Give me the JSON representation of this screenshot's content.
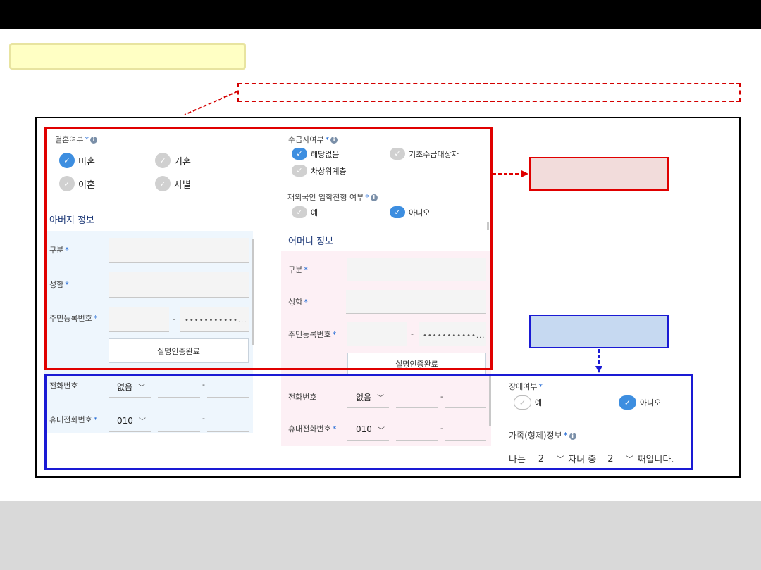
{
  "icons": {
    "check": "check-icon",
    "info": "info-icon",
    "chevron": "chevron-down-icon"
  },
  "colors": {
    "red_highlight": "#e00000",
    "blue_highlight": "#1a1ad4",
    "radio_selected": "#3d8ee0"
  },
  "marital": {
    "label": "결혼여부",
    "required": "*",
    "info": "i",
    "options": [
      {
        "label": "미혼",
        "selected": true
      },
      {
        "label": "기혼",
        "selected": false
      },
      {
        "label": "이혼",
        "selected": false
      },
      {
        "label": "사별",
        "selected": false
      }
    ]
  },
  "welfare": {
    "label": "수급자여부",
    "required": "*",
    "info": "i",
    "options": [
      {
        "label": "해당없음",
        "selected": true
      },
      {
        "label": "기초수급대상자",
        "selected": false
      },
      {
        "label": "차상위계층",
        "selected": false
      }
    ]
  },
  "overseas": {
    "label": "재외국인 입학전형 여부",
    "required": "*",
    "info": "i",
    "options": [
      {
        "label": "예",
        "selected": false
      },
      {
        "label": "아니오",
        "selected": true
      }
    ]
  },
  "father": {
    "title": "아버지 정보",
    "type_label": "구분",
    "name_label": "성함",
    "rrn_label": "주민등록번호",
    "rrn_mask": "•••••••••••...",
    "verify_button": "실명인증완료",
    "phone_label": "전화번호",
    "phone_prefix": "없음",
    "mobile_label": "휴대전화번호",
    "mobile_prefix": "010",
    "required": "*",
    "dash": "-"
  },
  "mother": {
    "title": "어머니 정보",
    "type_label": "구분",
    "name_label": "성함",
    "rrn_label": "주민등록번호",
    "rrn_mask": "•••••••••••...",
    "verify_button": "실명인증완료",
    "phone_label": "전화번호",
    "phone_prefix": "없음",
    "mobile_label": "휴대전화번호",
    "mobile_prefix": "010",
    "required": "*",
    "dash": "-"
  },
  "disability": {
    "label": "장애여부",
    "required": "*",
    "options": [
      {
        "label": "예",
        "selected": false
      },
      {
        "label": "아니오",
        "selected": true
      }
    ]
  },
  "family": {
    "label": "가족(형제)정보",
    "required": "*",
    "info": "i",
    "prefix": "나는",
    "total": "2",
    "middle": "자녀 중",
    "order": "2",
    "suffix": "째입니다."
  }
}
